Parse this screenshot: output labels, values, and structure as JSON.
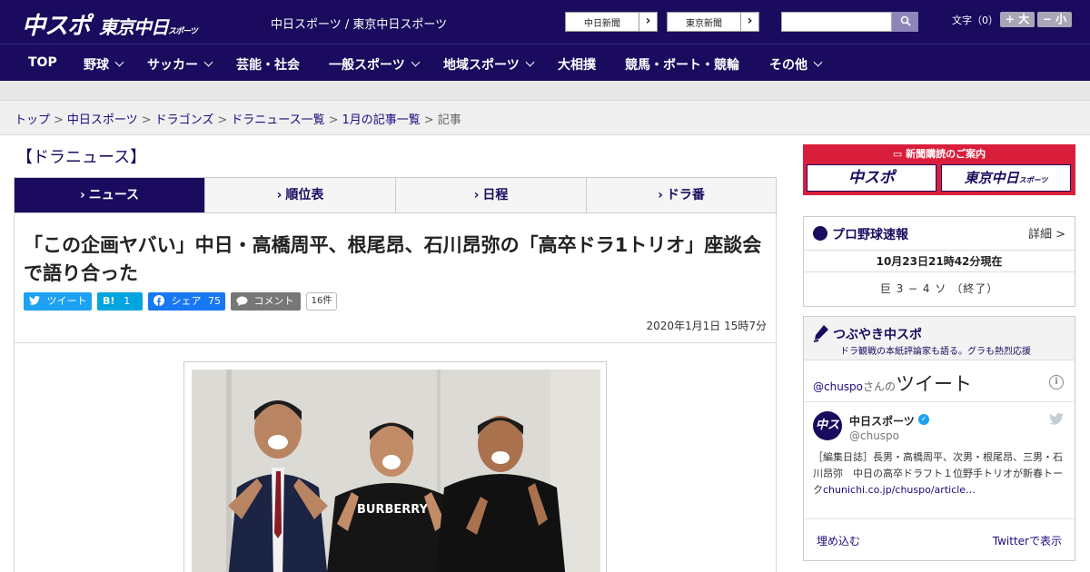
{
  "header": {
    "logo": {
      "chuspo": "中スポ",
      "tokyo": "東京中日",
      "small": "スポーツ"
    },
    "site_links": "中日スポーツ / 東京中日スポーツ",
    "paper_buttons": [
      "中日新聞",
      "東京新聞"
    ],
    "search": {
      "placeholder": ""
    },
    "fontsize": {
      "label": "文字（0）",
      "large": "+ 大",
      "small": "− 小"
    }
  },
  "nav": {
    "items": [
      {
        "label": "TOP",
        "dropdown": false
      },
      {
        "label": "野球",
        "dropdown": true
      },
      {
        "label": "サッカー",
        "dropdown": true
      },
      {
        "label": "芸能・社会",
        "dropdown": false
      },
      {
        "label": "一般スポーツ",
        "dropdown": true
      },
      {
        "label": "地域スポーツ",
        "dropdown": true
      },
      {
        "label": "大相撲",
        "dropdown": false
      },
      {
        "label": "競馬・ボート・競輪",
        "dropdown": false
      },
      {
        "label": "その他",
        "dropdown": true
      }
    ]
  },
  "breadcrumb": {
    "items": [
      "トップ",
      "中日スポーツ",
      "ドラゴンズ",
      "ドラニュース一覧",
      "1月の記事一覧"
    ],
    "current": "記事",
    "separator": ">"
  },
  "section_title": "【ドラニュース】",
  "tabs": [
    {
      "label": "ニュース",
      "active": true
    },
    {
      "label": "順位表",
      "active": false
    },
    {
      "label": "日程",
      "active": false
    },
    {
      "label": "ドラ番",
      "active": false
    }
  ],
  "article": {
    "headline": "「この企画ヤバい」中日・高橋周平、根尾昂、石川昂弥の「高卒ドラ1トリオ」座談会で語り合った",
    "share": {
      "tweet": "ツイート",
      "hatena_label": "B!",
      "hatena_count": "1",
      "facebook": "シェア",
      "facebook_count": "75",
      "comment": "コメント",
      "comment_count": "16件"
    },
    "date": "2020年1月1日 15時7分"
  },
  "sidebar": {
    "ad": {
      "label": "新聞購読のご案内",
      "chuspo": "中スポ",
      "tokyo": "東京中日",
      "tokyo_small": "スポーツ"
    },
    "scores": {
      "title": "プロ野球速報",
      "detail": "詳細 >",
      "time": "10月23日21時42分現在",
      "line": "巨 3 − 4 ソ （終了）"
    },
    "twitter": {
      "title": "つぶやき中スポ",
      "subtitle": "ドラ観戦の本紙評論家も語る。グラも熱烈応援",
      "handle": "@chuspo",
      "handle_suffix": "さんの",
      "tweet_word": "ツイート",
      "account_name": "中日スポーツ",
      "screen_name": "@chuspo",
      "tweet_text": "［編集日誌］長男・高橋周平、次男・根尾昂、三男・石川昂弥　中日の高卒ドラフト１位野手トリオが新春トーク",
      "tweet_link": "chunichi.co.jp/chuspo/article…",
      "embed": "埋め込む",
      "view_on_twitter": "Twitterで表示"
    }
  },
  "colors": {
    "brand_navy": "#1a0b5e",
    "ad_red": "#d91e3c",
    "twitter_blue": "#1da1f2",
    "facebook_blue": "#1877f2"
  }
}
